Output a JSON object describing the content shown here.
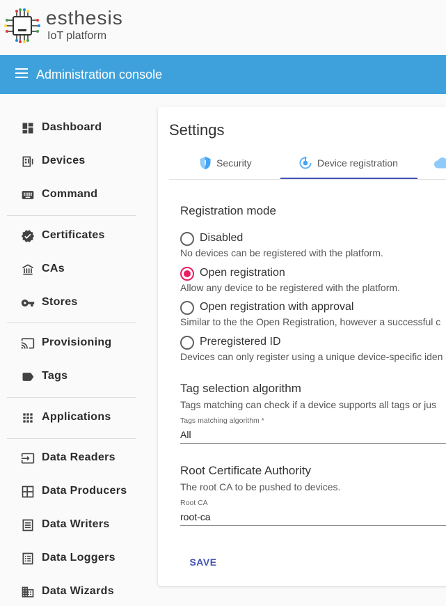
{
  "brand": {
    "name": "esthesis",
    "tagline": "IoT platform"
  },
  "topbar": {
    "title": "Administration console"
  },
  "sidebar": {
    "items": [
      {
        "label": "Dashboard",
        "icon": "dashboard-icon"
      },
      {
        "label": "Devices",
        "icon": "devices-icon"
      },
      {
        "label": "Command",
        "icon": "keyboard-icon"
      },
      {
        "label": "Certificates",
        "icon": "verified-badge-icon"
      },
      {
        "label": "CAs",
        "icon": "account-balance-icon"
      },
      {
        "label": "Stores",
        "icon": "key-icon"
      },
      {
        "label": "Provisioning",
        "icon": "cast-icon"
      },
      {
        "label": "Tags",
        "icon": "label-icon"
      },
      {
        "label": "Applications",
        "icon": "apps-grid-icon"
      },
      {
        "label": "Data Readers",
        "icon": "input-icon"
      },
      {
        "label": "Data Producers",
        "icon": "dashboard-quilt-icon"
      },
      {
        "label": "Data Writers",
        "icon": "notes-icon"
      },
      {
        "label": "Data Loggers",
        "icon": "list-alt-icon"
      },
      {
        "label": "Data Wizards",
        "icon": "building-icon"
      }
    ]
  },
  "settings": {
    "title": "Settings",
    "tabs": [
      {
        "label": "Security",
        "icon": "shield-icon",
        "active": false
      },
      {
        "label": "Device registration",
        "icon": "registration-icon",
        "active": true
      },
      {
        "label": "",
        "icon": "cloud-icon",
        "active": false
      }
    ],
    "registration": {
      "title": "Registration mode",
      "options": [
        {
          "label": "Disabled",
          "help": "No devices can be registered with the platform.",
          "selected": false
        },
        {
          "label": "Open registration",
          "help": "Allow any device to be registered with the platform.",
          "selected": true
        },
        {
          "label": "Open registration with approval",
          "help": "Similar to the the Open Registration, however a successful c",
          "selected": false
        },
        {
          "label": "Preregistered ID",
          "help": "Devices can only register using a unique device-specific iden",
          "selected": false
        }
      ]
    },
    "tags": {
      "title": "Tag selection algorithm",
      "help": "Tags matching can check if a device supports all tags or jus",
      "field_label": "Tags matching algorithm *",
      "field_value": "All"
    },
    "root_ca": {
      "title": "Root Certificate Authority",
      "help": "The root CA to be pushed to devices.",
      "field_label": "Root CA",
      "field_value": "root-ca"
    },
    "save_label": "SAVE"
  },
  "colors": {
    "topbar": "#3fa1db",
    "accent": "#3f51b5",
    "radio_selected": "#e91e63"
  }
}
